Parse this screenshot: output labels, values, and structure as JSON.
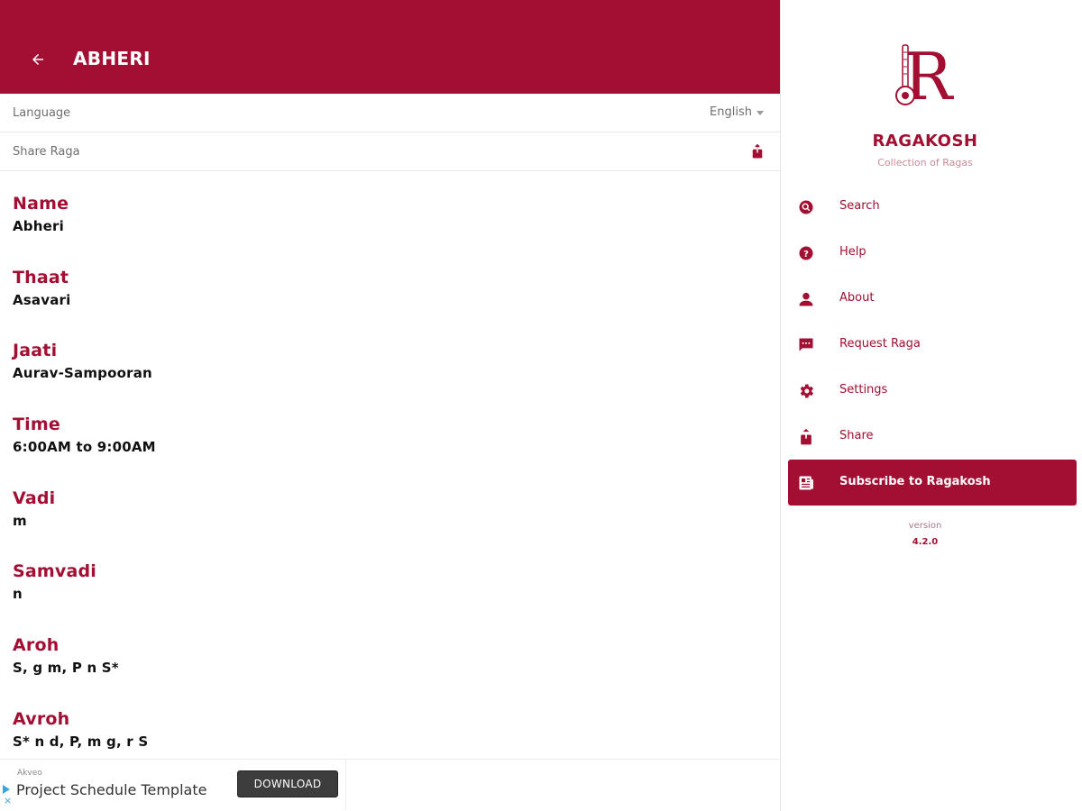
{
  "appbar": {
    "title": "ABHERI",
    "back_icon": "arrow-left-icon"
  },
  "settings": {
    "language_label": "Language",
    "language_value": "English",
    "share_label": "Share Raga",
    "share_icon": "share-icon"
  },
  "raga": {
    "fields": [
      {
        "label": "Name",
        "value": "Abheri"
      },
      {
        "label": "Thaat",
        "value": "Asavari"
      },
      {
        "label": "Jaati",
        "value": "Aurav-Sampooran"
      },
      {
        "label": "Time",
        "value": "6:00AM to 9:00AM"
      },
      {
        "label": "Vadi",
        "value": "m"
      },
      {
        "label": "Samvadi",
        "value": "n"
      },
      {
        "label": "Aroh",
        "value": "S, g m, P n S*"
      },
      {
        "label": "Avroh",
        "value": "S* n d, P, m g, r S"
      }
    ]
  },
  "ad": {
    "sponsor": "Akveo",
    "title": "Project Schedule Template",
    "button": "DOWNLOAD",
    "close": "×"
  },
  "drawer": {
    "app_name": "RAGAKOSH",
    "app_subtitle": "Collection of Ragas",
    "menu": [
      {
        "label": "Search",
        "icon": "search-icon"
      },
      {
        "label": "Help",
        "icon": "help-icon"
      },
      {
        "label": "About",
        "icon": "person-icon"
      },
      {
        "label": "Request Raga",
        "icon": "message-icon"
      },
      {
        "label": "Settings",
        "icon": "gear-icon"
      },
      {
        "label": "Share",
        "icon": "share-icon"
      },
      {
        "label": "Subscribe to Ragakosh",
        "icon": "newspaper-icon",
        "active": true
      }
    ],
    "version_label": "version",
    "version_number": "4.2.0"
  },
  "colors": {
    "primary": "#a20f32",
    "surface": "#ffffff",
    "divider": "#e6e6e6"
  }
}
